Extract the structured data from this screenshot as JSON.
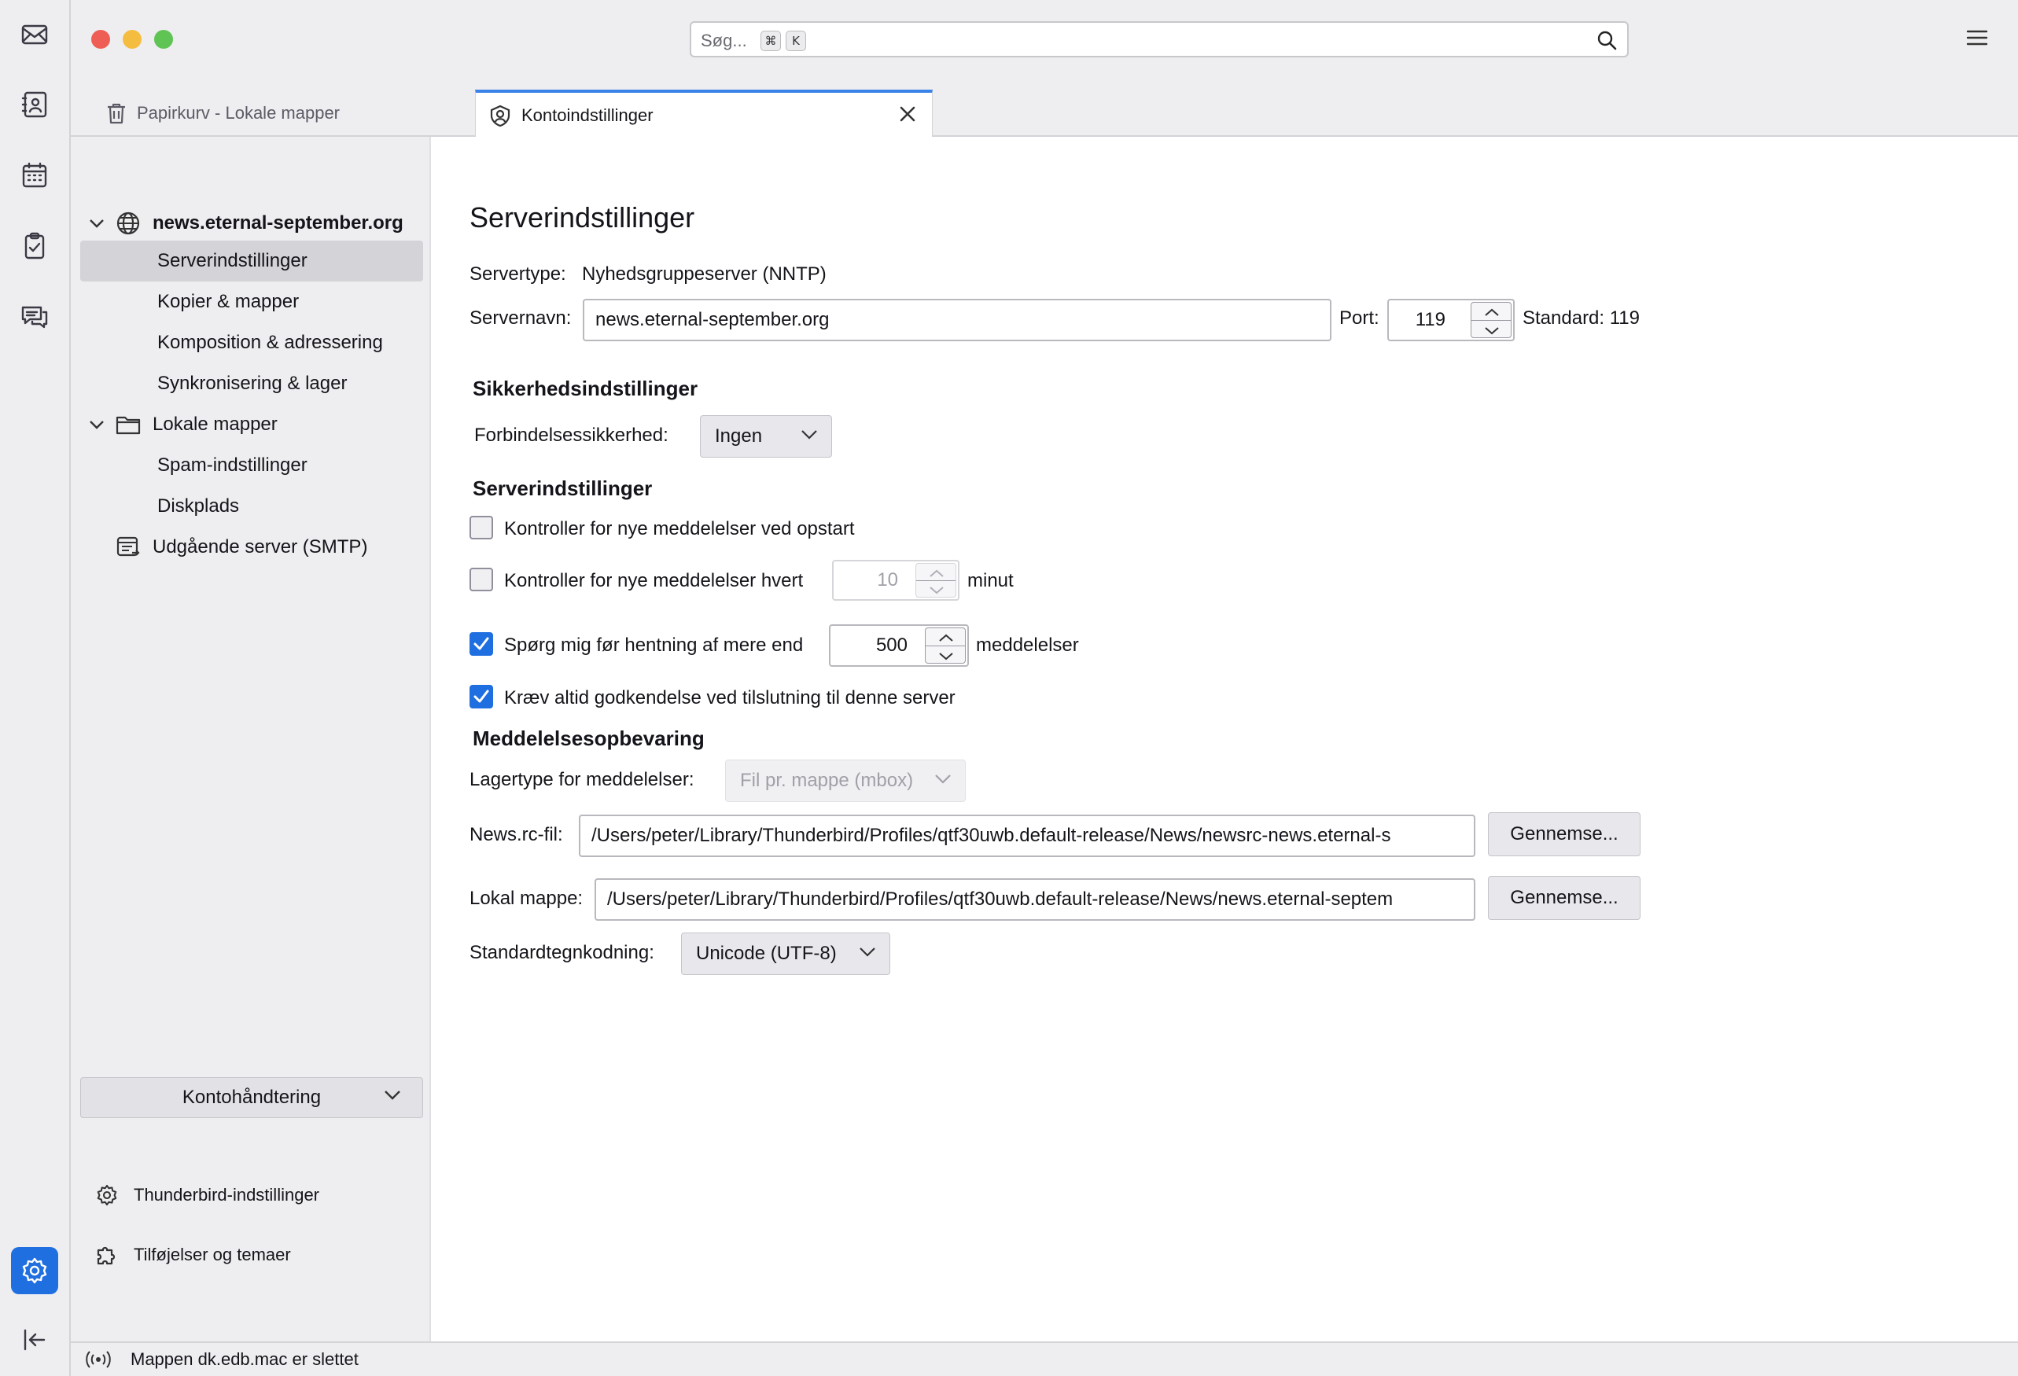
{
  "window": {
    "search_placeholder": "Søg...",
    "shortcut_cmd": "⌘",
    "shortcut_key": "K"
  },
  "spaces": [
    "mail-icon",
    "address-book-icon",
    "calendar-icon",
    "tasks-icon",
    "chat-icon",
    "settings-icon",
    "collapse-icon"
  ],
  "tabs": [
    {
      "label": "Papirkurv - Lokale mapper",
      "active": false
    },
    {
      "label": "Kontoindstillinger",
      "active": true
    }
  ],
  "tree": {
    "account1": "news.eternal-september.org",
    "account1_items": [
      "Serverindstillinger",
      "Kopier & mapper",
      "Komposition & adressering",
      "Synkronisering & lager"
    ],
    "account2": "Lokale mapper",
    "account2_items": [
      "Spam-indstillinger",
      "Diskplads"
    ],
    "smtp": "Udgående server (SMTP)",
    "account_actions": "Kontohåndtering",
    "thunderbird_settings": "Thunderbird-indstillinger",
    "addons": "Tilføjelser og temaer"
  },
  "main": {
    "title": "Serverindstillinger",
    "server_type_label": "Servertype:",
    "server_type_value": "Nyhedsgruppeserver (NNTP)",
    "server_name_label": "Servernavn:",
    "server_name_value": "news.eternal-september.org",
    "port_label": "Port:",
    "port_value": "119",
    "port_default": "Standard: 119",
    "security_heading": "Sikkerhedsindstillinger",
    "connection_security_label": "Forbindelsessikkerhed:",
    "connection_security_value": "Ingen",
    "server_settings_heading": "Serverindstillinger",
    "check_startup_label": "Kontroller for nye meddelelser ved opstart",
    "check_startup_checked": false,
    "check_every_label": "Kontroller for nye meddelelser hvert",
    "check_every_checked": false,
    "check_every_value": "10",
    "check_every_unit": "minut",
    "ask_before_label": "Spørg mig før hentning af mere end",
    "ask_before_checked": true,
    "ask_before_value": "500",
    "ask_before_unit": "meddelelser",
    "always_auth_label": "Kræv altid godkendelse ved tilslutning til denne server",
    "always_auth_checked": true,
    "storage_heading": "Meddelelsesopbevaring",
    "store_type_label": "Lagertype for meddelelser:",
    "store_type_value": "Fil pr. mappe (mbox)",
    "newsrc_label": "News.rc-fil:",
    "newsrc_value": "/Users/peter/Library/Thunderbird/Profiles/qtf30uwb.default-release/News/newsrc-news.eternal-s",
    "browse_label": "Gennemse...",
    "local_dir_label": "Lokal mappe:",
    "local_dir_value": "/Users/peter/Library/Thunderbird/Profiles/qtf30uwb.default-release/News/news.eternal-septem",
    "charset_label": "Standardtegnkodning:",
    "charset_value": "Unicode (UTF-8)"
  },
  "status": {
    "text": "Mappen dk.edb.mac er slettet"
  },
  "colors": {
    "accent": "#1f6fe0",
    "close": "#ee5e55",
    "minimize": "#f5bd3f",
    "maximize": "#5fc454"
  }
}
